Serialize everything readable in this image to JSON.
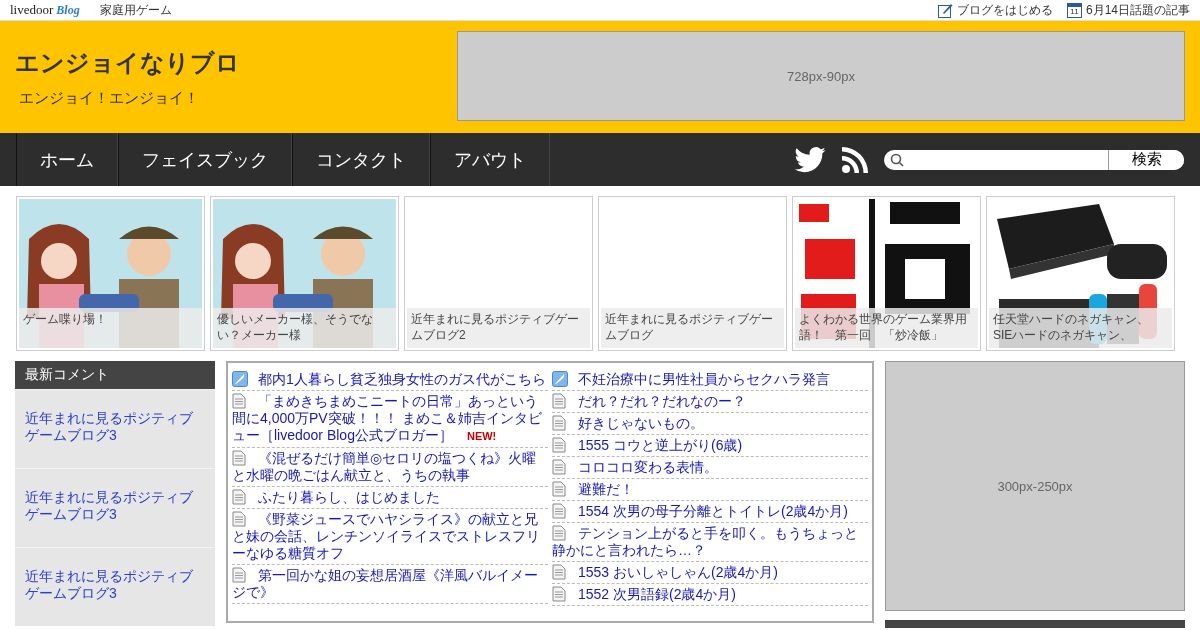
{
  "topbar": {
    "brand": "livedoor",
    "brand_sub": "Blog",
    "category": "家庭用ゲーム",
    "links": [
      {
        "kind": "pen",
        "label": "ブログをはじめる"
      },
      {
        "kind": "calendar",
        "label": "6月14日話題の記事",
        "icon_text": "11"
      }
    ]
  },
  "header": {
    "title": "エンジョイなりブロ",
    "subtitle": "エンジョイ！エンジョイ！",
    "ad": "728px-90px"
  },
  "nav": {
    "items": [
      "ホーム",
      "フェイスブック",
      "コンタクト",
      "アバウト"
    ],
    "search_button": "検索"
  },
  "thumbnails": [
    {
      "caption": "ゲーム喋り場！",
      "kind": "picture"
    },
    {
      "caption": "優しいメーカー様、そうでない？メーカー様",
      "kind": "picture"
    },
    {
      "caption": "近年まれに見るポジティブゲームブログ2",
      "kind": "blank"
    },
    {
      "caption": "近年まれに見るポジティブゲームブログ",
      "kind": "blank"
    },
    {
      "caption": "よくわかる世界のゲーム業界用語！　第一回　「炒冷飯」",
      "kind": "picture"
    },
    {
      "caption": "任天堂ハードのネガキャン、SIEハードのネガキャン、",
      "kind": "picture"
    }
  ],
  "sidebar": {
    "title": "最新コメント",
    "items": [
      "近年まれに見るポジティブゲームブログ3",
      "近年まれに見るポジティブゲームブログ3",
      "近年まれに見るポジティブゲームブログ3"
    ]
  },
  "articles": [
    [
      {
        "kind": "pen",
        "title": "都内1人暮らし貧乏独身女性のガス代がこちら"
      },
      {
        "kind": "doc",
        "title": "「まめきちまめこニートの日常」あっという間に4,000万PV突破！！！ まめこ＆姉吉インタビュー［livedoor Blog公式ブロガー］",
        "badge": "NEW!"
      },
      {
        "kind": "doc",
        "title": "《混ぜるだけ簡単◎セロリの塩つくね》火曜と水曜の晩ごはん献立と、うちの執事"
      },
      {
        "kind": "doc",
        "title": "ふたり暮らし、はじめました"
      },
      {
        "kind": "doc",
        "title": "《野菜ジュースでハヤシライス》の献立と兄と妹の会話、レンチンソイライスでストレスフリーなゆる糖質オフ"
      },
      {
        "kind": "doc",
        "title": "第一回かな姐の妄想居酒屋《洋風バルイメージで》"
      }
    ],
    [
      {
        "kind": "pen",
        "title": "不妊治療中に男性社員からセクハラ発言"
      },
      {
        "kind": "doc",
        "title": "だれ？だれ？だれなのー？"
      },
      {
        "kind": "doc",
        "title": "好きじゃないもの。"
      },
      {
        "kind": "doc",
        "title": "1555 コウと逆上がり(6歳)"
      },
      {
        "kind": "doc",
        "title": "コロコロ変わる表情。"
      },
      {
        "kind": "doc",
        "title": "避難だ！"
      },
      {
        "kind": "doc",
        "title": "1554 次男の母子分離とトイトレ(2歳4か月)"
      },
      {
        "kind": "doc",
        "title": "テンション上がると手を叩く。もうちょっと静かにと言われたら…？"
      },
      {
        "kind": "doc",
        "title": "1553 おいしゃしゃん(2歳4か月)"
      },
      {
        "kind": "doc",
        "title": "1552 次男語録(2歳4か月)"
      }
    ]
  ],
  "right_ad": "300px-250px"
}
